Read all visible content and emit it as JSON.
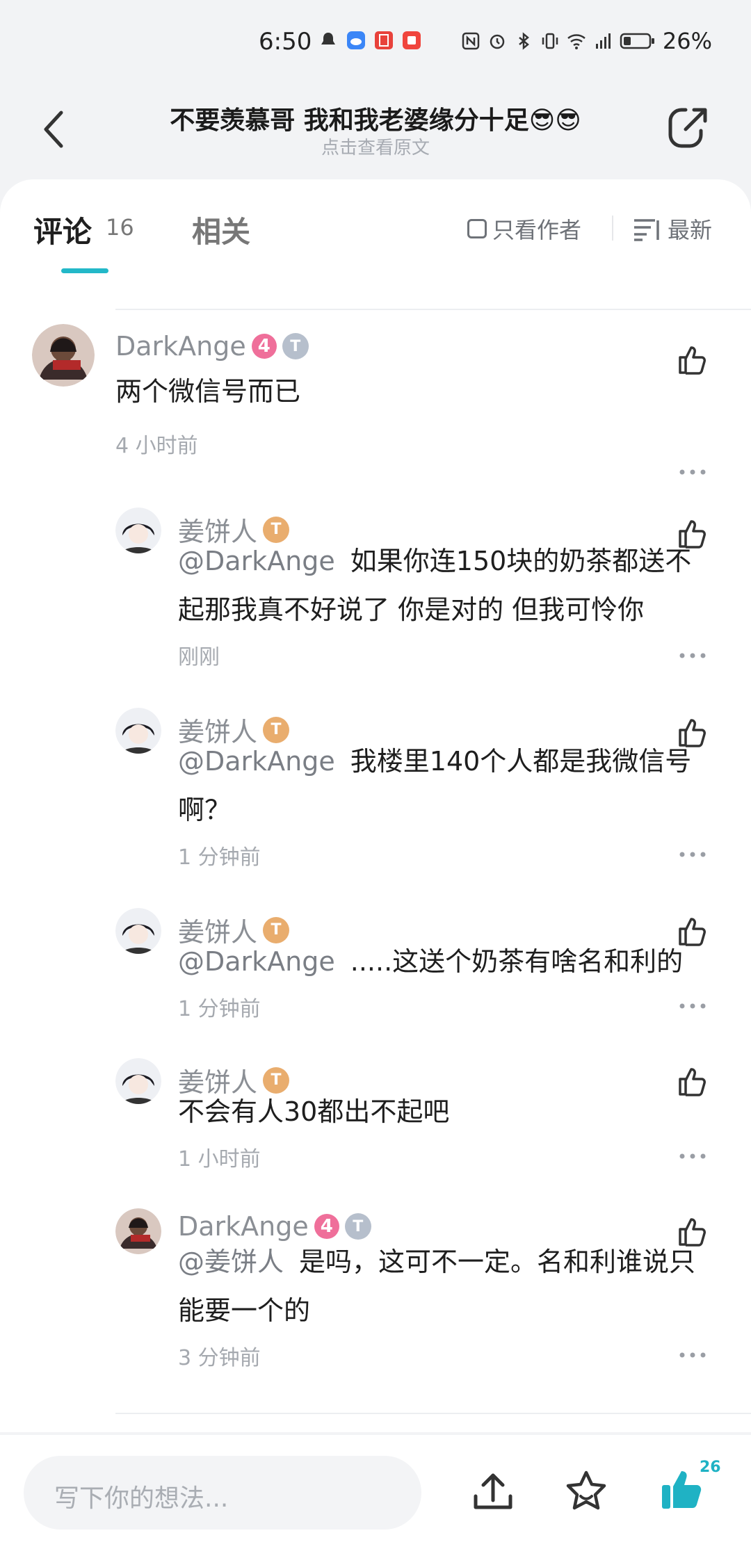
{
  "status_bar": {
    "time": "6:50",
    "battery": "26%"
  },
  "header": {
    "title": "不要羡慕哥 我和我老婆缘分十足😎😎",
    "subtitle": "点击查看原文"
  },
  "tabs": {
    "comment_label": "评论",
    "comment_count": "16",
    "related_label": "相关"
  },
  "filters": {
    "only_author": "只看作者",
    "sort": "最新"
  },
  "comments": [
    {
      "name": "DarkAnge",
      "level": "4",
      "text": "两个微信号而已",
      "time": "4 小时前"
    },
    {
      "name": "姜饼人",
      "mention": "@DarkAnge",
      "text": "如果你连150块的奶茶都送不起那我真不好说了 你是对的 但我可怜你",
      "time": "刚刚"
    },
    {
      "name": "姜饼人",
      "mention": "@DarkAnge",
      "text": "我楼里140个人都是我微信号啊？",
      "time": "1 分钟前"
    },
    {
      "name": "姜饼人",
      "mention": "@DarkAnge",
      "text": ".....这送个奶茶有啥名和利的",
      "time": "1 分钟前"
    },
    {
      "name": "姜饼人",
      "text": "不会有人30都出不起吧",
      "time": "1 小时前"
    },
    {
      "name": "DarkAnge",
      "level": "4",
      "mention": "@姜饼人",
      "text": "是吗，这可不一定。名和利谁说只能要一个的",
      "time": "3 分钟前"
    }
  ],
  "bottom_bar": {
    "input_placeholder": "写下你的想法...",
    "like_count": "26"
  },
  "colors": {
    "accent": "#23b8c8",
    "level_badge": "#ef6f9a",
    "gold_badge": "#e9ad6e"
  }
}
